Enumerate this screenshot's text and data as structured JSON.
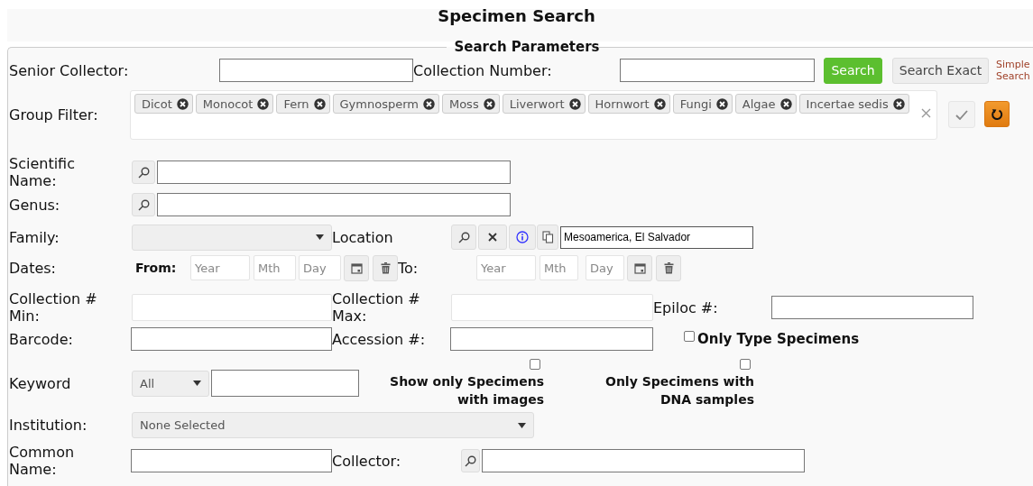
{
  "title": "Specimen Search",
  "legend": "Search Parameters",
  "top_row": {
    "senior_collector_label": "Senior Collector:",
    "collection_number_label": "Collection Number:",
    "simple_search_link": "Simple Search",
    "buttons": [
      {
        "label": "Search",
        "kind": "primary"
      },
      {
        "label": "Search Exact",
        "kind": "default"
      }
    ]
  },
  "group_filter": {
    "label": "Group Filter:",
    "tags": [
      "Dicot",
      "Monocot",
      "Fern",
      "Gymnosperm",
      "Moss",
      "Liverwort",
      "Hornwort",
      "Fungi",
      "Algae",
      "Incertae sedis"
    ]
  },
  "scientific_name": {
    "label": "Scientific Name:"
  },
  "genus": {
    "label": "Genus:"
  },
  "family": {
    "label": "Family:"
  },
  "location": {
    "label": "Location",
    "value": "Mesoamerica, El Salvador"
  },
  "dates": {
    "label": "Dates:",
    "from": {
      "label": "From:",
      "placeholders": [
        "Year",
        "Mth",
        "Day"
      ]
    },
    "to": {
      "label": "To:",
      "placeholders": [
        "Year",
        "Mth",
        "Day"
      ]
    }
  },
  "collection_min": {
    "label": "Collection # Min:"
  },
  "collection_max": {
    "label": "Collection # Max:"
  },
  "epiloc": {
    "label": "Epiloc #:"
  },
  "barcode": {
    "label": "Barcode:"
  },
  "accession": {
    "label": "Accession #:"
  },
  "only_type": {
    "label": "Only Type Specimens",
    "checked": false
  },
  "keyword": {
    "label": "Keyword",
    "scope": "All"
  },
  "with_images": {
    "label": "Show only Specimens with images",
    "checked": false
  },
  "with_dna": {
    "label": "Only Specimens with DNA samples",
    "checked": false
  },
  "institution": {
    "label": "Institution:",
    "value": "None Selected"
  },
  "common_name": {
    "label": "Common Name:"
  },
  "collector": {
    "label": "Collector:"
  }
}
